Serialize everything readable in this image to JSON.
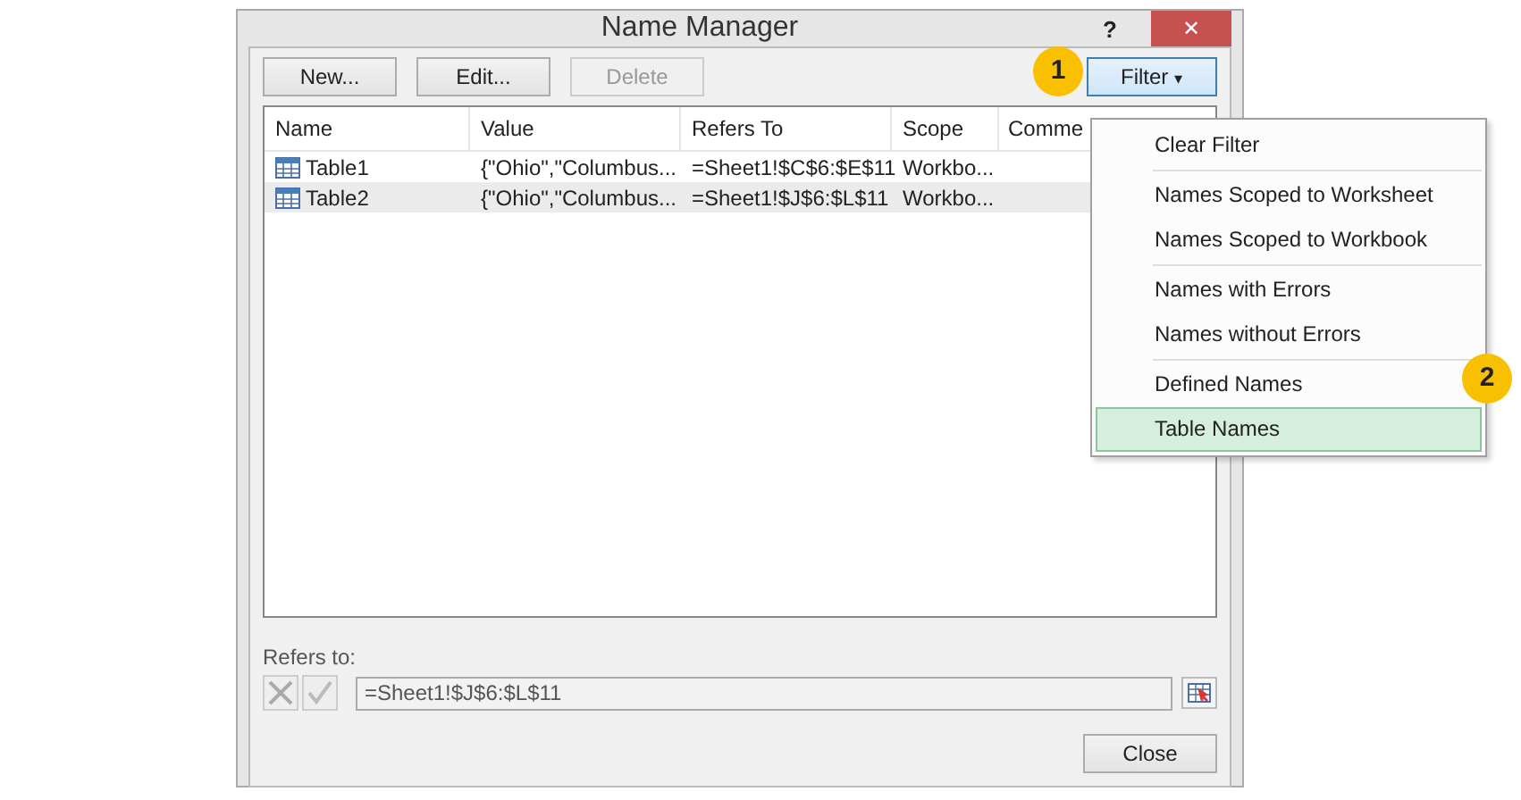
{
  "window": {
    "title": "Name Manager",
    "help": "?",
    "close": "✕"
  },
  "toolbar": [
    {
      "label": "New...",
      "disabled": false
    },
    {
      "label": "Edit...",
      "disabled": false
    },
    {
      "label": "Delete",
      "disabled": true
    }
  ],
  "filter_button": {
    "label": "Filter",
    "caret": "▾"
  },
  "table": {
    "columns": [
      "Name",
      "Value",
      "Refers To",
      "Scope",
      "Comme"
    ],
    "rows": [
      {
        "cells": [
          "Table1",
          "{\"Ohio\",\"Columbus...",
          "=Sheet1!$C$6:$E$11",
          "Workbo..."
        ],
        "selected": false
      },
      {
        "cells": [
          "Table2",
          "{\"Ohio\",\"Columbus...",
          "=Sheet1!$J$6:$L$11",
          "Workbo..."
        ],
        "selected": true
      }
    ]
  },
  "refers_to": {
    "label": "Refers to:",
    "value": "=Sheet1!$J$6:$L$11"
  },
  "close_button": "Close",
  "filter_menu": [
    [
      {
        "label": "Clear Filter",
        "selected": false
      }
    ],
    [
      {
        "label": "Names Scoped to Worksheet",
        "selected": false
      },
      {
        "label": "Names Scoped to Workbook",
        "selected": false
      }
    ],
    [
      {
        "label": "Names with Errors",
        "selected": false
      },
      {
        "label": "Names without Errors",
        "selected": false
      }
    ],
    [
      {
        "label": "Defined Names",
        "selected": false
      },
      {
        "label": "Table Names",
        "selected": true
      }
    ]
  ],
  "callouts": [
    "1",
    "2"
  ]
}
